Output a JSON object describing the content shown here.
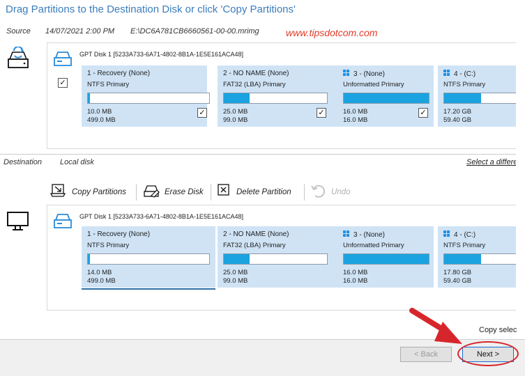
{
  "title": "Drag Partitions to the Destination Disk or click 'Copy Partitions'",
  "source": {
    "label": "Source",
    "date": "14/07/2021 2:00 PM",
    "path": "E:\\DC6A781CB6660561-00-00.mrimg"
  },
  "watermark": "www.tipsdotcom.com",
  "source_disk": {
    "header": "GPT Disk 1 [5233A733-6A71-4802-8B1A-1E5E161ACA48]",
    "partitions": [
      {
        "name": "1 - Recovery (None)",
        "type": "NTFS Primary",
        "used": "10.0 MB",
        "total": "499.0 MB",
        "fill": 0.02,
        "checked": "✓"
      },
      {
        "name": "2 - NO NAME (None)",
        "type": "FAT32 (LBA) Primary",
        "used": "25.0 MB",
        "total": "99.0 MB",
        "fill": 0.25,
        "checked": "✓"
      },
      {
        "name": "3 -  (None)",
        "type": "Unformatted Primary",
        "used": "16.0 MB",
        "total": "16.0 MB",
        "fill": 1.0,
        "checked": "✓"
      },
      {
        "name": "4 -  (C:)",
        "type": "NTFS Primary",
        "used": "17.20 GB",
        "total": "59.40 GB",
        "fill": 0.45,
        "checked": ""
      }
    ],
    "disk_checked": "✓"
  },
  "destination": {
    "label": "Destination",
    "disk": "Local disk",
    "select_link": "Select a different"
  },
  "toolbar": {
    "copy_partitions": "Copy Partitions",
    "erase_disk": "Erase Disk",
    "delete_partition": "Delete Partition",
    "undo": "Undo"
  },
  "dest_disk": {
    "header": "GPT Disk 1 [5233A733-6A71-4802-8B1A-1E5E161ACA48]",
    "partitions": [
      {
        "name": "1 - Recovery (None)",
        "type": "NTFS Primary",
        "used": "14.0 MB",
        "total": "499.0 MB",
        "fill": 0.02
      },
      {
        "name": "2 - NO NAME (None)",
        "type": "FAT32 (LBA) Primary",
        "used": "25.0 MB",
        "total": "99.0 MB",
        "fill": 0.25
      },
      {
        "name": "3 -  (None)",
        "type": "Unformatted Primary",
        "used": "16.0 MB",
        "total": "16.0 MB",
        "fill": 1.0
      },
      {
        "name": "4 -  (C:)",
        "type": "NTFS Primary",
        "used": "17.80 GB",
        "total": "59.40 GB",
        "fill": 0.45
      }
    ]
  },
  "copy_selected_label": "Copy selec",
  "buttons": {
    "back": "< Back",
    "next": "Next >"
  },
  "colors": {
    "partition_bg": "#cfe3f5",
    "fill_bar": "#1aa3e0",
    "title": "#3b7dbd",
    "watermark": "#e03a2a",
    "annotation": "#d7262b"
  }
}
